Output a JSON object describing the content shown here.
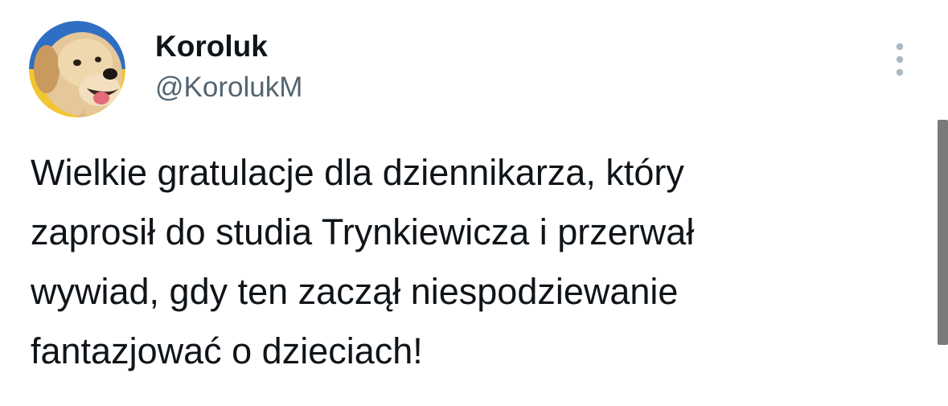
{
  "author": {
    "display_name": "Koroluk",
    "handle": "@KorolukM",
    "avatar_icon": "golden-retriever-puppy-avatar",
    "avatar_colors": {
      "flag_blue": "#2f6fc3",
      "flag_yellow": "#f2c531"
    }
  },
  "menu": {
    "icon": "more-vertical-icon"
  },
  "tweet": {
    "lines": [
      "Wielkie gratulacje dla dziennikarza, który",
      "zaprosił do studia Trynkiewicza i przerwał",
      "wywiad, gdy ten zaczął niespodziewanie",
      "fantazjować o dzieciach!"
    ]
  },
  "colors": {
    "text_primary": "#0f1419",
    "text_secondary": "#536471",
    "background": "#ffffff",
    "menu_dots": "#aab8c2",
    "scrollbar": "#7a7a7a"
  }
}
